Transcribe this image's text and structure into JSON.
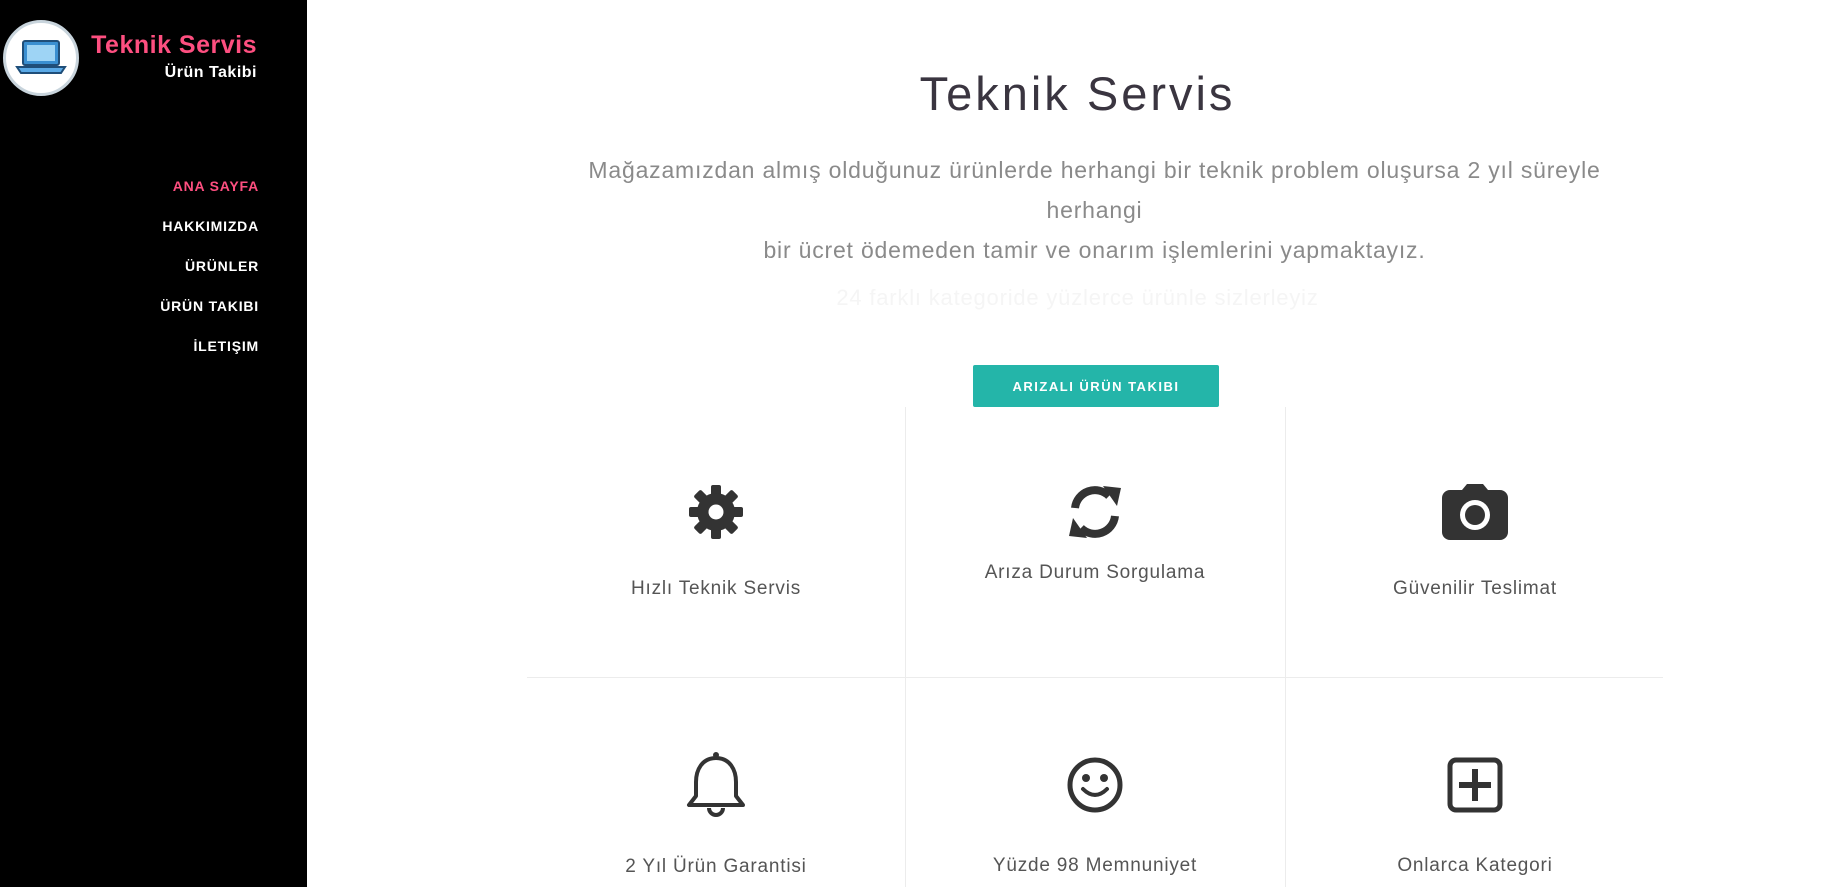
{
  "sidebar": {
    "logo_icon": "laptop-icon",
    "brand_title": "Teknik Servis",
    "brand_subtitle": "Ürün Takibi",
    "nav": [
      {
        "label": "ANA SAYFA",
        "active": true
      },
      {
        "label": "HAKKIMIZDA",
        "active": false
      },
      {
        "label": "ÜRÜNLER",
        "active": false
      },
      {
        "label": "ÜRÜN TAKIBI",
        "active": false
      },
      {
        "label": "İLETIŞIM",
        "active": false
      }
    ]
  },
  "hero": {
    "title": "Teknik Servis",
    "description_line1": "Mağazamızdan almış olduğunuz ürünlerde herhangi bir teknik problem oluşursa 2 yıl süreyle herhangi",
    "description_line2": "bir ücret ödemeden tamir ve onarım işlemlerini yapmaktayız.",
    "faint_text": "24 farklı kategoride yüzlerce ürünle sizlerleyiz",
    "cta_label": "ARIZALI ÜRÜN TAKIBI"
  },
  "features": [
    {
      "icon": "gear-icon",
      "label": "Hızlı Teknik Servis"
    },
    {
      "icon": "refresh-icon",
      "label": "Arıza Durum Sorgulama"
    },
    {
      "icon": "camera-icon",
      "label": "Güvenilir Teslimat"
    },
    {
      "icon": "bell-icon",
      "label": "2 Yıl Ürün Garantisi"
    },
    {
      "icon": "smile-icon",
      "label": "Yüzde 98 Memnuniyet"
    },
    {
      "icon": "plus-square-icon",
      "label": "Onlarca Kategori"
    }
  ],
  "colors": {
    "accent_pink": "#fe4f80",
    "button_teal": "#24b5a9",
    "sidebar_bg": "#000000",
    "icon_dark": "#333333"
  }
}
